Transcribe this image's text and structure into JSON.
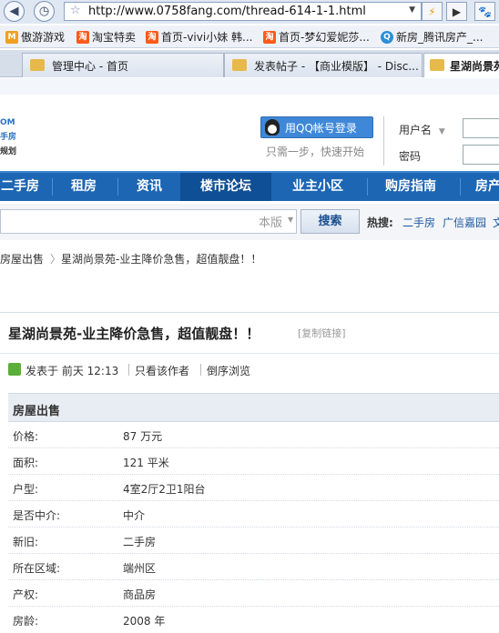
{
  "browser": {
    "url": "http://www.0758fang.com/thread-614-1-1.html",
    "bookmarks": [
      {
        "label": "傲游游戏",
        "icon": "maxthon-icon",
        "color": "#f0a020"
      },
      {
        "label": "淘宝特卖",
        "icon": "taobao-icon",
        "color": "#ff5a1a"
      },
      {
        "label": "首页-vivi小妹 韩...",
        "icon": "taobao-icon",
        "color": "#ff5a1a"
      },
      {
        "label": "首页-梦幻爱妮莎...",
        "icon": "taobao-icon",
        "color": "#ff5a1a"
      },
      {
        "label": "新房_腾讯房产_...",
        "icon": "tencent-icon",
        "color": "#2a8fd8"
      }
    ],
    "tabs": [
      {
        "label": "管理中心 - 首页"
      },
      {
        "label": "发表帖子 - 【商业模版】 - Disc..."
      },
      {
        "label": "星湖尚景苑"
      }
    ]
  },
  "header": {
    "logo_fragments": [
      "OM",
      "手房",
      "规划"
    ],
    "qq_login": "用QQ帐号登录",
    "qq_sub": "只需一步，快速开始",
    "username_label": "用户名",
    "password_label": "密码"
  },
  "nav": [
    "二手房",
    "租房",
    "资讯",
    "楼市论坛",
    "业主小区",
    "购房指南",
    "房产"
  ],
  "search": {
    "scope": "本版",
    "button": "搜索",
    "hot_label": "热搜:",
    "hot_links": [
      "二手房",
      "广信嘉园",
      "文"
    ]
  },
  "breadcrumb": [
    "房屋出售",
    "星湖尚景苑-业主降价急售，超值靓盘！！"
  ],
  "thread": {
    "title": "星湖尚景苑-业主降价急售，超值靓盘！！",
    "copy_link": "[复制链接]",
    "posted": "发表于 前天 12:13",
    "only_author": "只看该作者",
    "reverse": "倒序浏览"
  },
  "info": {
    "heading": "房屋出售",
    "rows": [
      {
        "key": "价格:",
        "value": "87 万元"
      },
      {
        "key": "面积:",
        "value": "121 平米"
      },
      {
        "key": "户型:",
        "value": "4室2厅2卫1阳台"
      },
      {
        "key": "是否中介:",
        "value": "中介"
      },
      {
        "key": "新旧:",
        "value": "二手房"
      },
      {
        "key": "所在区域:",
        "value": "端州区"
      },
      {
        "key": "产权:",
        "value": "商品房"
      },
      {
        "key": "房龄:",
        "value": "2008 年"
      }
    ]
  }
}
